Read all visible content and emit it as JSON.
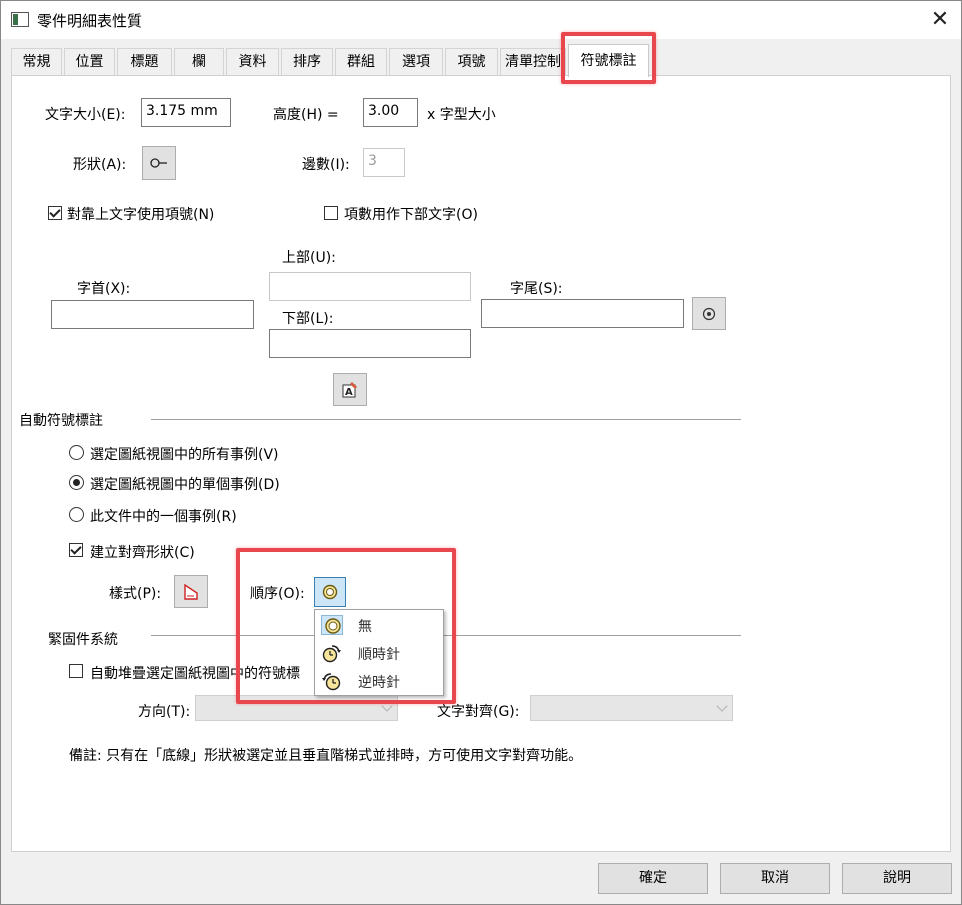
{
  "window": {
    "title": "零件明細表性質",
    "close_glyph": "✕"
  },
  "tabs": [
    "常規",
    "位置",
    "標題",
    "欄",
    "資料",
    "排序",
    "群組",
    "選項",
    "項號",
    "清單控制",
    "符號標註"
  ],
  "active_tab": "符號標註",
  "text_size": {
    "label": "文字大小(E):",
    "value": "3.175 mm"
  },
  "height": {
    "label": "高度(H) =",
    "value": "3.00",
    "suffix": "x 字型大小"
  },
  "shape": {
    "label": "形狀(A):",
    "icon": "balloon-shape-icon"
  },
  "sides": {
    "label": "邊數(I):",
    "value": "3"
  },
  "align_text_item": {
    "label": "對靠上文字使用項號(N)",
    "checked": true
  },
  "qty_lower_text": {
    "label": "項數用作下部文字(O)",
    "checked": false
  },
  "upper": {
    "label": "上部(U):",
    "value": ""
  },
  "lower": {
    "label": "下部(L):",
    "value": ""
  },
  "prefix": {
    "label": "字首(X):",
    "value": ""
  },
  "suffix": {
    "label": "字尾(S):",
    "value": ""
  },
  "auto_balloon": {
    "section_label": "自動符號標註",
    "options": [
      {
        "label": "選定圖紙視圖中的所有事例(V)",
        "selected": false
      },
      {
        "label": "選定圖紙視圖中的單個事例(D)",
        "selected": true
      },
      {
        "label": "此文件中的一個事例(R)",
        "selected": false
      }
    ],
    "create_align_shape": {
      "label": "建立對齊形狀(C)",
      "checked": true
    },
    "style_label": "樣式(P):",
    "order_label": "順序(O):"
  },
  "order_dropdown": {
    "items": [
      {
        "label": "無",
        "icon": "no-order-icon",
        "selected": true
      },
      {
        "label": "順時針",
        "icon": "clockwise-icon",
        "selected": false
      },
      {
        "label": "逆時針",
        "icon": "counterclockwise-icon",
        "selected": false
      }
    ]
  },
  "fastener": {
    "section_label": "緊固件系統",
    "auto_stack": {
      "label": "自動堆疊選定圖紙視圖中的符號標",
      "checked": false
    },
    "direction_label": "方向(T):",
    "text_align_label": "文字對齊(G):"
  },
  "note": "備註: 只有在「底線」形狀被選定並且垂直階梯式並排時，方可使用文字對齊功能。",
  "buttons": {
    "ok": "確定",
    "cancel": "取消",
    "help": "說明"
  },
  "colors": {
    "highlight": "#e8474d",
    "panel": "#ffffff",
    "dialog": "#f0f0f0"
  }
}
